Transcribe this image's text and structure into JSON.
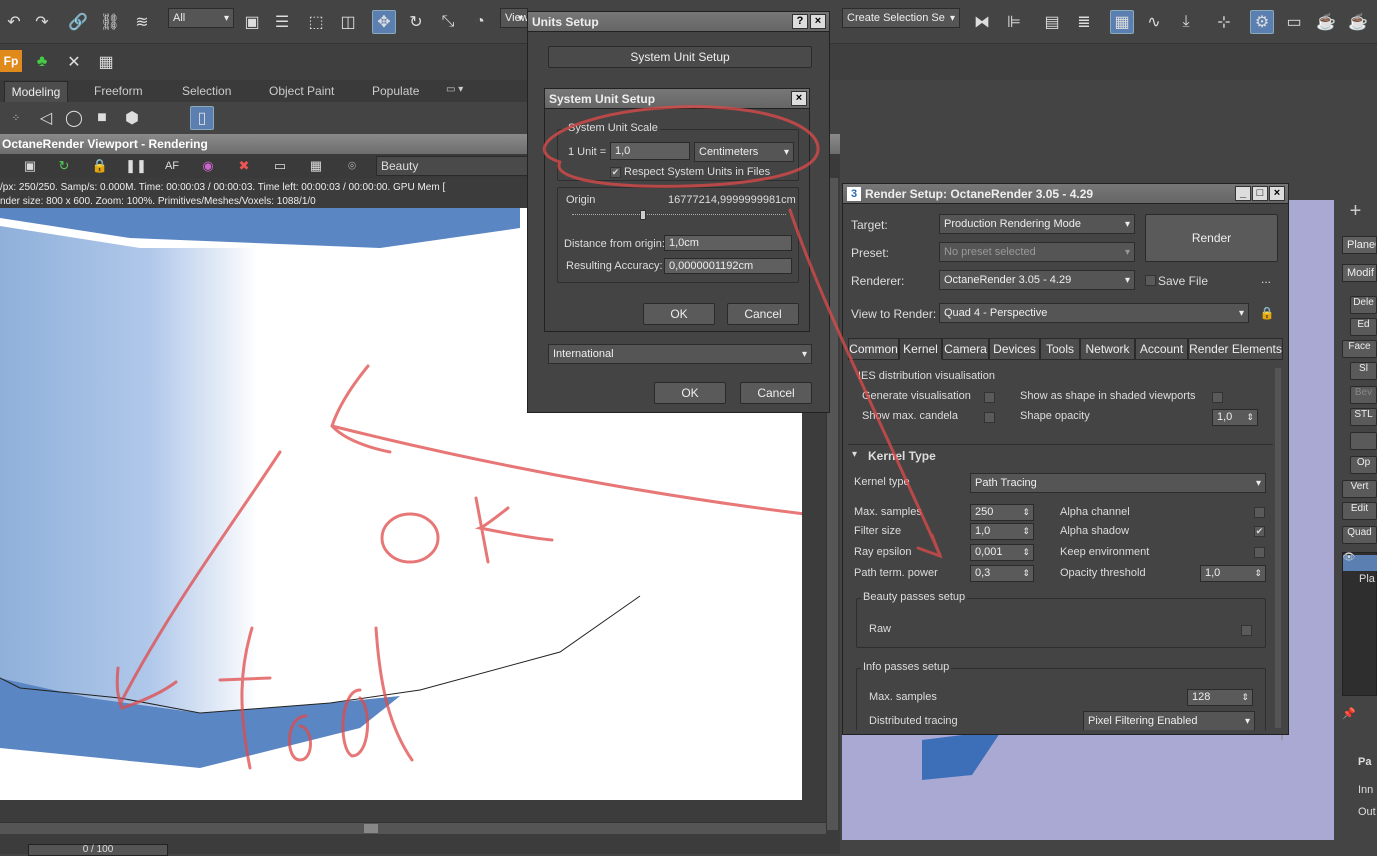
{
  "main_toolbar": {
    "selection_filter": "All",
    "view_dropdown": "View",
    "named_selection": "Create Selection Se"
  },
  "ribbon": {
    "tabs": [
      "Modeling",
      "Freeform",
      "Selection",
      "Object Paint",
      "Populate"
    ]
  },
  "viewport": {
    "title": "OctaneRender Viewport - Rendering",
    "pass": "Beauty",
    "stats_line1": "/px: 250/250.   Samp/s: 0.000M.   Time: 00:00:03 / 00:00:03.   Time left: 00:00:03 / 00:00:00.   GPU Mem [",
    "stats_line2": "nder size: 800 x 600.   Zoom: 100%.   Primitives/Meshes/Voxels: 1088/1/0",
    "timeline": "0 / 100"
  },
  "annotation": {
    "text1": "OK",
    "text2": "fail"
  },
  "units_setup": {
    "title": "Units Setup",
    "help": "?",
    "close": "×",
    "system_unit_setup_button": "System Unit Setup",
    "lighting_units_value": "International",
    "ok": "OK",
    "cancel": "Cancel"
  },
  "system_unit_setup": {
    "title": "System Unit Setup",
    "close": "×",
    "group_label": "System Unit Scale",
    "unit_label": "1 Unit =",
    "unit_value": "1,0",
    "unit_type": "Centimeters",
    "respect_label": "Respect System Units in Files",
    "respect_checked": "✔",
    "origin_label": "Origin",
    "origin_value": "16777214,9999999981cm",
    "distance_label": "Distance from origin:",
    "distance_value": "1,0cm",
    "accuracy_label": "Resulting Accuracy:",
    "accuracy_value": "0,0000001192cm",
    "ok": "OK",
    "cancel": "Cancel"
  },
  "render_setup": {
    "title": "Render Setup: OctaneRender 3.05 - 4.29",
    "icon_text": "3",
    "target_label": "Target:",
    "target_value": "Production Rendering Mode",
    "preset_label": "Preset:",
    "preset_value": "No preset selected",
    "renderer_label": "Renderer:",
    "renderer_value": "OctaneRender 3.05 - 4.29",
    "save_file": "Save File",
    "more": "...",
    "render_button": "Render",
    "view_label": "View to Render:",
    "view_value": "Quad 4 - Perspective",
    "tabs": [
      "Common",
      "Kernel",
      "Camera",
      "Devices",
      "Tools",
      "Network",
      "Account",
      "Render Elements"
    ],
    "ies": {
      "header": "IES distribution visualisation",
      "gen": "Generate visualisation",
      "show_max": "Show max. candela",
      "show_shape": "Show as shape in shaded viewports",
      "shape_opacity": "Shape opacity",
      "shape_opacity_value": "1,0"
    },
    "kernel": {
      "header": "Kernel Type",
      "collapse": "▾",
      "type_label": "Kernel type",
      "type_value": "Path Tracing",
      "max_samples_label": "Max. samples",
      "max_samples": "250",
      "filter_label": "Filter size",
      "filter": "1,0",
      "ray_label": "Ray epsilon",
      "ray": "0,001",
      "path_label": "Path term. power",
      "path": "0,3",
      "alpha_channel": "Alpha channel",
      "alpha_shadow": "Alpha shadow",
      "alpha_shadow_checked": "✔",
      "keep_env": "Keep environment",
      "opacity_label": "Opacity threshold",
      "opacity": "1,0"
    },
    "beauty": {
      "header": "Beauty passes setup",
      "raw": "Raw"
    },
    "info": {
      "header": "Info passes setup",
      "max_label": "Max. samples",
      "max": "128",
      "dist_label": "Distributed tracing",
      "dist": "Pixel Filtering Enabled"
    }
  },
  "command_panel": {
    "items": [
      "Plane0",
      "Modif",
      "Dele",
      "Ed",
      "Face",
      "Sl",
      "Bev",
      "STL",
      "",
      "Op",
      "Vert",
      "Edit",
      "Quad"
    ],
    "stack": [
      "",
      "Pla"
    ],
    "params": "Pa",
    "inner": "Inn",
    "outer": "Out"
  }
}
